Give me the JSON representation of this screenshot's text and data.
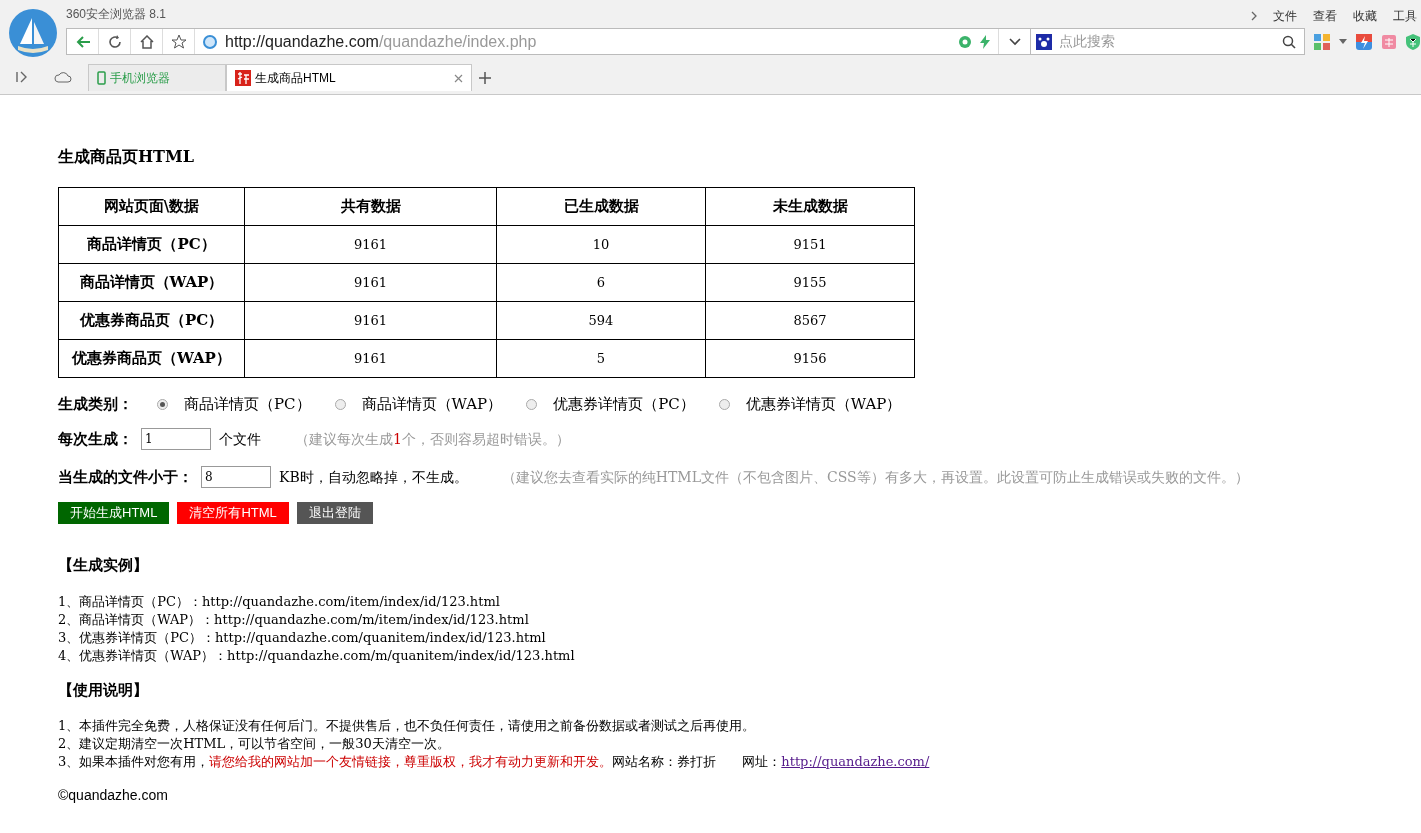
{
  "browser": {
    "title": "360安全浏览器 8.1",
    "menu": [
      "文件",
      "查看",
      "收藏",
      "工具"
    ],
    "url_host": "http://quandazhe.com",
    "url_path": "/quandazhe/index.php",
    "search_placeholder": "点此搜索",
    "tabs": [
      {
        "label": "手机浏览器",
        "selected": false,
        "kind": "phone"
      },
      {
        "label": "生成商品HTML",
        "selected": true,
        "kind": "site"
      }
    ]
  },
  "page": {
    "heading": "生成商品页HTML",
    "table": {
      "columns": [
        "网站页面\\数据",
        "共有数据",
        "已生成数据",
        "未生成数据"
      ],
      "rows": [
        [
          "商品详情页（PC）",
          "9161",
          "10",
          "9151"
        ],
        [
          "商品详情页（WAP）",
          "9161",
          "6",
          "9155"
        ],
        [
          "优惠券商品页（PC）",
          "9161",
          "594",
          "8567"
        ],
        [
          "优惠券商品页（WAP）",
          "9161",
          "5",
          "9156"
        ]
      ]
    },
    "type_label": "生成类别：",
    "type_options": [
      {
        "label": "商品详情页（PC）",
        "selected": true
      },
      {
        "label": "商品详情页（WAP）",
        "selected": false
      },
      {
        "label": "优惠券详情页（PC）",
        "selected": false
      },
      {
        "label": "优惠券详情页（WAP）",
        "selected": false
      }
    ],
    "per_label": "每次生成：",
    "per_value": "1",
    "per_unit": "个文件",
    "per_hint": [
      {
        "text": "（建议每次生成",
        "kind": "plain"
      },
      {
        "text": "1",
        "kind": "alert"
      },
      {
        "text": "个，否则容易超时错误。）",
        "kind": "plain"
      }
    ],
    "size_label": "当生成的文件小于：",
    "size_value": "8",
    "size_unit": "KB时，自动忽略掉，不生成。",
    "size_hint": "（建议您去查看实际的纯HTML文件（不包含图片、CSS等）有多大，再设置。此设置可防止生成错误或失败的文件。）",
    "buttons": [
      {
        "label": "开始生成HTML",
        "kind": "start"
      },
      {
        "label": "清空所有HTML",
        "kind": "clear"
      },
      {
        "label": "退出登陆",
        "kind": "logout"
      }
    ],
    "example_heading": "【生成实例】",
    "examples": [
      "1、商品详情页（PC）：http://quandazhe.com/item/index/id/123.html",
      "2、商品详情页（WAP）：http://quandazhe.com/m/item/index/id/123.html",
      "3、优惠券详情页（PC）：http://quandazhe.com/quanitem/index/id/123.html",
      "4、优惠券详情页（WAP）：http://quandazhe.com/m/quanitem/index/id/123.html"
    ],
    "usage_heading": "【使用说明】",
    "usage": [
      [
        {
          "text": "1、本插件完全免费，人格保证没有任何后门。不提供售后，也不负任何责任，请使用之前备份数据或者测试之后再使用。",
          "kind": "plain"
        }
      ],
      [
        {
          "text": "2、建议定期清空一次HTML，可以节省空间，一般30天清空一次。",
          "kind": "plain"
        }
      ],
      [
        {
          "text": "3、如果本插件对您有用，",
          "kind": "plain"
        },
        {
          "text": "请您给我的网站加一个友情链接，尊重版权，我才有动力更新和开发。",
          "kind": "alert"
        },
        {
          "text": "网站名称：券打折　　网址：",
          "kind": "plain"
        },
        {
          "text": "http://quandazhe.com/",
          "kind": "link"
        }
      ]
    ],
    "footer": "©quandazhe.com"
  }
}
